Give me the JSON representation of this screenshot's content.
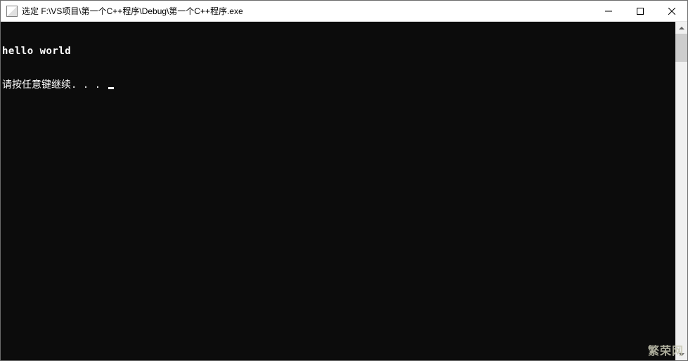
{
  "titlebar": {
    "text": "选定 F:\\VS项目\\第一个C++程序\\Debug\\第一个C++程序.exe"
  },
  "console": {
    "line1": "hello world",
    "line2_prefix": "请按任意键继续. . . "
  },
  "watermark": "繁荣网"
}
